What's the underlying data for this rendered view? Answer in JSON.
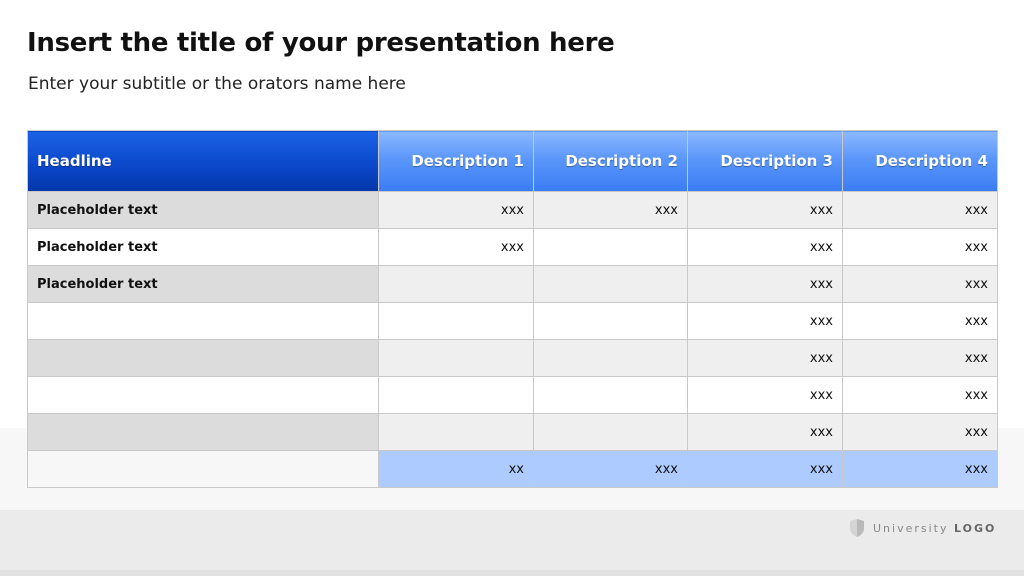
{
  "slide": {
    "title": "Insert the title of your presentation here",
    "subtitle": "Enter your subtitle or the orators name here"
  },
  "table": {
    "headers": [
      "Headline",
      "Description 1",
      "Description 2",
      "Description 3",
      "Description 4"
    ],
    "rows": [
      [
        "Placeholder text",
        "xxx",
        "xxx",
        "xxx",
        "xxx"
      ],
      [
        "Placeholder text",
        "xxx",
        "",
        "xxx",
        "xxx"
      ],
      [
        "Placeholder text",
        "",
        "",
        "xxx",
        "xxx"
      ],
      [
        "",
        "",
        "",
        "xxx",
        "xxx"
      ],
      [
        "",
        "",
        "",
        "xxx",
        "xxx"
      ],
      [
        "",
        "",
        "",
        "xxx",
        "xxx"
      ],
      [
        "",
        "",
        "",
        "xxx",
        "xxx"
      ],
      [
        "",
        "xx",
        "xxx",
        "xxx",
        "xxx"
      ]
    ]
  },
  "logo": {
    "text_light": "University",
    "text_bold": "LOGO"
  },
  "colors": {
    "header_dark_blue": "#0b46c8",
    "header_light_blue": "#5b97fa",
    "total_row_blue": "#aecbff"
  },
  "icons": {
    "logo": "shield-icon"
  }
}
